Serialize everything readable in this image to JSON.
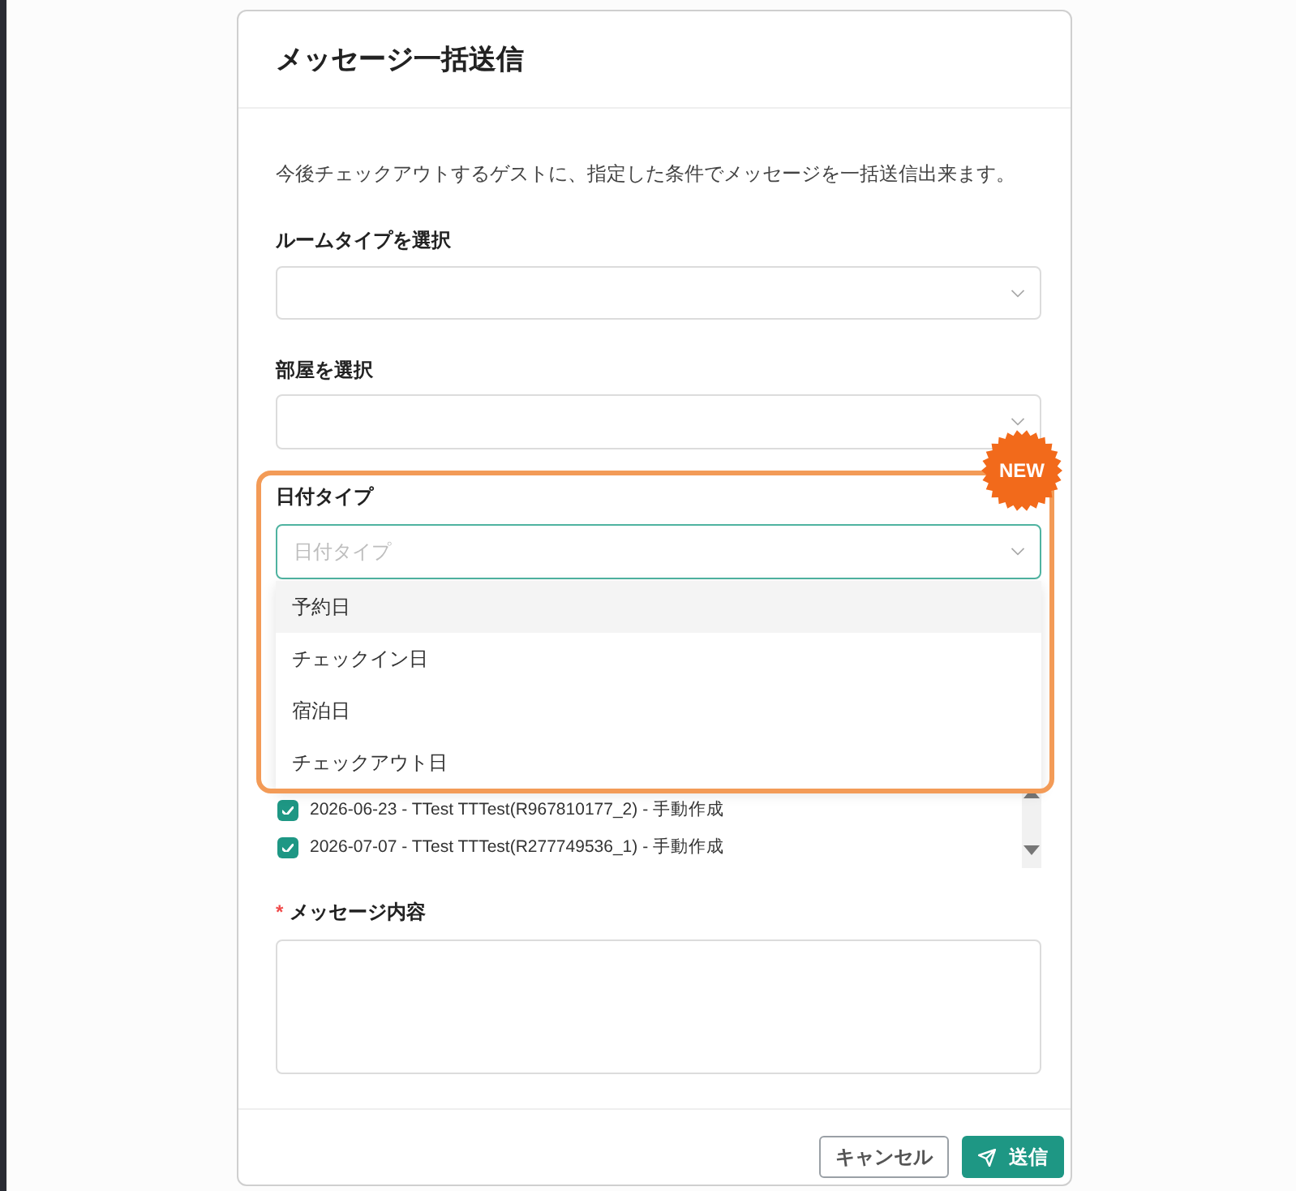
{
  "dialog": {
    "title": "メッセージ一括送信",
    "description": "今後チェックアウトするゲストに、指定した条件でメッセージを一括送信出来ます。",
    "fields": [
      {
        "kind": "select",
        "label": "ルームタイプを選択"
      },
      {
        "kind": "select",
        "label": "部屋を選択"
      }
    ],
    "date_type": {
      "label": "日付タイプ",
      "placeholder": "日付タイプ",
      "badge": "NEW",
      "expanded": true,
      "options": [
        {
          "label": "予約日",
          "highlighted": true
        },
        {
          "label": "チェックイン日",
          "highlighted": false
        },
        {
          "label": "宿泊日",
          "highlighted": false
        },
        {
          "label": "チェックアウト日",
          "highlighted": false
        }
      ]
    },
    "reservations": [
      {
        "label": "2026-06-23 - TTest TTTest(R967810177_2) - 手動作成",
        "checked": true
      },
      {
        "label": "2026-07-07 - TTest TTTest(R277749536_1) - 手動作成",
        "checked": true
      }
    ],
    "message": {
      "required_mark": "*",
      "label": "メッセージ内容"
    },
    "buttons": [
      {
        "kind": "secondary",
        "label": "キャンセル"
      },
      {
        "kind": "primary",
        "label": "送信"
      }
    ]
  }
}
